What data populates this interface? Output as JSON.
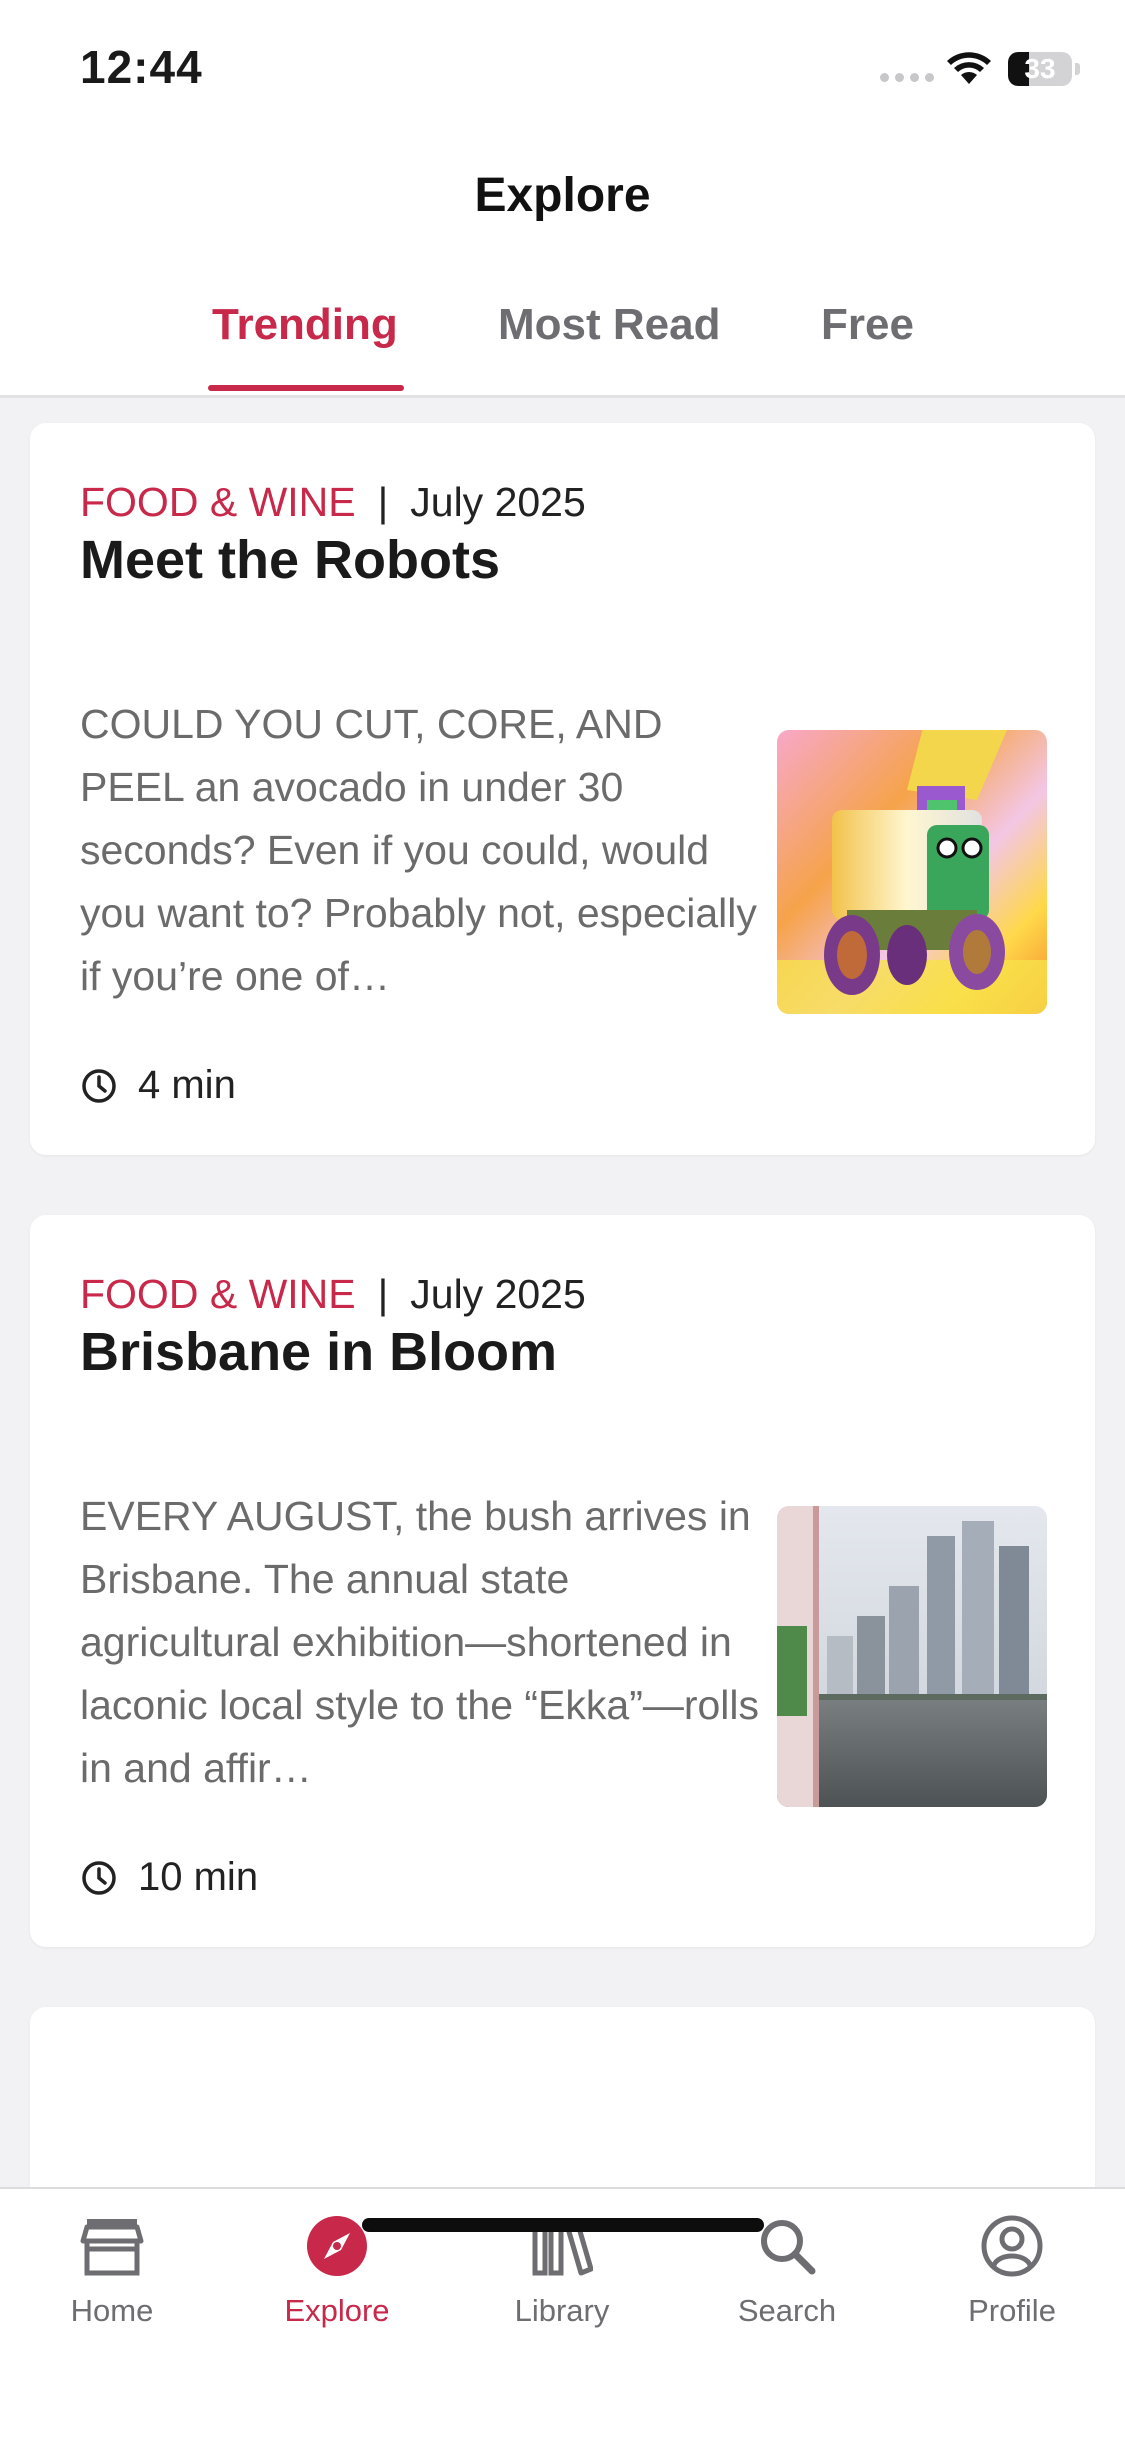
{
  "status_bar": {
    "time": "12:44",
    "battery": "33",
    "battery_level": 0.33
  },
  "header": {
    "title": "Explore"
  },
  "tabs": [
    {
      "label": "Trending",
      "active": true
    },
    {
      "label": "Most Read",
      "active": false
    },
    {
      "label": "Free",
      "active": false
    }
  ],
  "articles": [
    {
      "category": "FOOD & WINE",
      "separator": "|",
      "date": "July 2025",
      "title": "Meet the Robots",
      "excerpt": "COULD YOU CUT, CORE, AND PEEL an avocado in under 30 seconds? Even if you could, would you want to? Probably not, especially if you’re one of…",
      "read_time": "4 min",
      "thumbnail": "delivery-robot-illustration"
    },
    {
      "category": "FOOD & WINE",
      "separator": "|",
      "date": "July 2025",
      "title": "Brisbane in Bloom",
      "excerpt": "EVERY AUGUST, the bush arrives in Brisbane. The annual state agricultural exhibition—shortened in laconic local style to the “Ekka”—rolls in and affir…",
      "read_time": "10 min",
      "thumbnail": "brisbane-skyline-photo"
    }
  ],
  "bottom_nav": [
    {
      "label": "Home",
      "icon": "store-icon",
      "active": false
    },
    {
      "label": "Explore",
      "icon": "compass-icon",
      "active": true
    },
    {
      "label": "Library",
      "icon": "library-icon",
      "active": false
    },
    {
      "label": "Search",
      "icon": "search-icon",
      "active": false
    },
    {
      "label": "Profile",
      "icon": "profile-icon",
      "active": false
    }
  ],
  "colors": {
    "accent": "#c8284a",
    "text": "#1a1a1a",
    "muted": "#6e6e72",
    "background": "#f2f2f4"
  }
}
